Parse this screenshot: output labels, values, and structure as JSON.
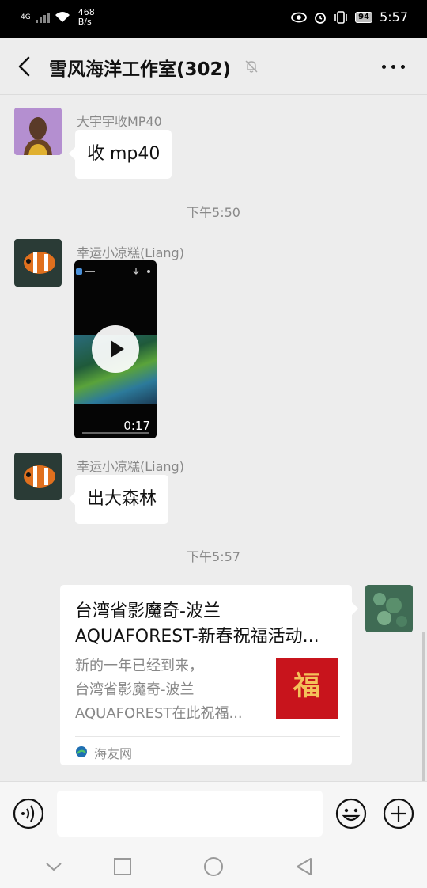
{
  "status_bar": {
    "network": "4G",
    "speed_value": "468",
    "speed_unit": "B/s",
    "battery": "94",
    "time": "5:57"
  },
  "header": {
    "title": "雪风海洋工作室(302)",
    "back_icon": "back-arrow-icon",
    "mute_icon": "muted-bell-icon",
    "more_icon": "more-dots-icon"
  },
  "messages": [
    {
      "type": "text",
      "sender": "大宇宇收MP40",
      "text": "收 mp40"
    },
    {
      "type": "time",
      "text": "下午5:50"
    },
    {
      "type": "video",
      "sender": "幸运小凉糕(Liang)",
      "duration": "0:17"
    },
    {
      "type": "text",
      "sender": "幸运小凉糕(Liang)",
      "text": "出大森林"
    },
    {
      "type": "time",
      "text": "下午5:57"
    },
    {
      "type": "link_card",
      "title_line1": "台湾省影魔奇-波兰",
      "title_line2": "AQUAFOREST-新春祝福活动...",
      "desc_line1": "新的一年已经到来，",
      "desc_line2": "台湾省影魔奇-波兰",
      "desc_line3": "AQUAFOREST在此祝福...",
      "thumb_text": "福",
      "source": "海友网"
    }
  ],
  "input_bar": {
    "placeholder": "",
    "voice_icon": "voice-icon",
    "emoji_icon": "emoji-icon",
    "plus_icon": "plus-icon"
  },
  "nav_bar": {
    "icons": [
      "collapse-icon",
      "recent-apps-icon",
      "home-icon",
      "back-triangle-icon"
    ]
  },
  "colors": {
    "background": "#ededed",
    "bubble": "#ffffff",
    "meta_text": "#888888",
    "thumb_red": "#c8141c"
  }
}
